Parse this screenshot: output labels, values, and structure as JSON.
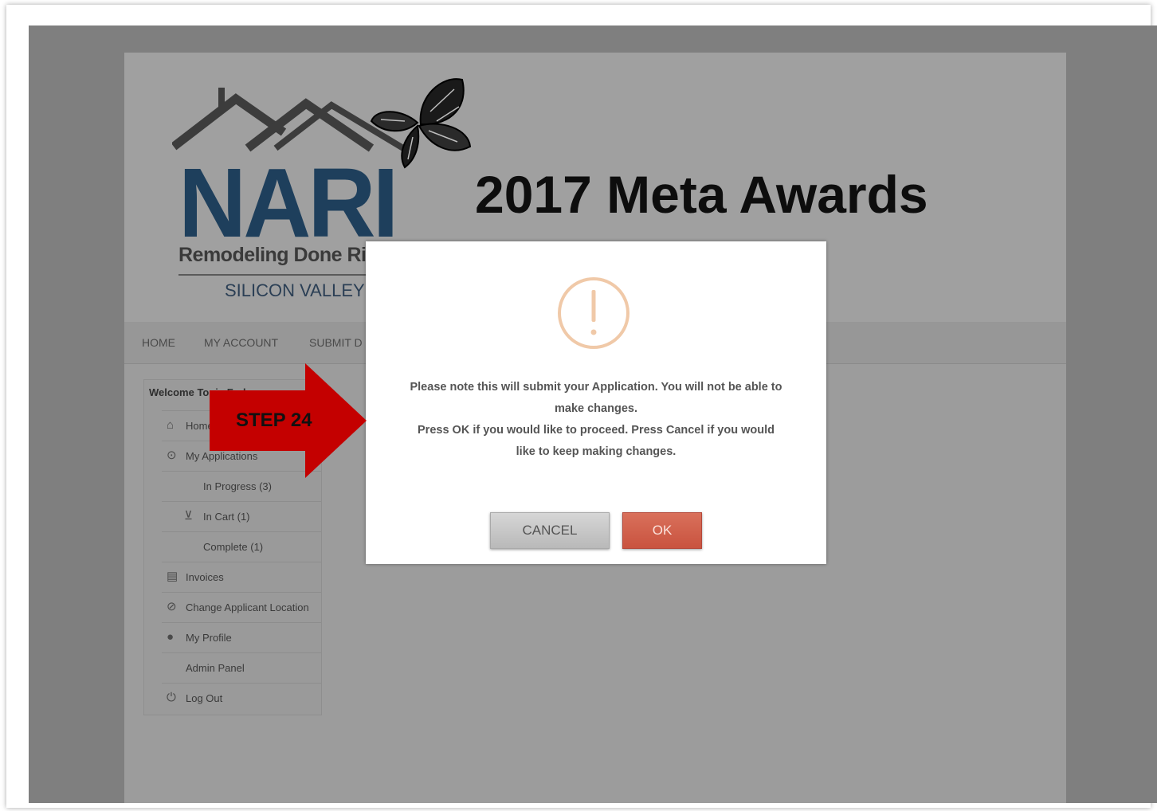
{
  "logo": {
    "wordmark": "NARI",
    "tagline": "Remodeling Done Right",
    "region": "SILICON VALLEY"
  },
  "header": {
    "title": "2017 Meta Awards"
  },
  "nav": {
    "items": [
      "HOME",
      "MY ACCOUNT",
      "SUBMIT D"
    ]
  },
  "sidebar": {
    "welcome": "Welcome Tonia Fodrus",
    "items": [
      {
        "label": "Home",
        "icon": "home-icon"
      },
      {
        "label": "My Applications",
        "icon": "applications-icon"
      },
      {
        "label": "In Progress (3)",
        "icon": ""
      },
      {
        "label": "In Cart (1)",
        "icon": "cart-icon"
      },
      {
        "label": "Complete (1)",
        "icon": ""
      },
      {
        "label": "Invoices",
        "icon": "invoice-icon"
      },
      {
        "label": "Change Applicant Location",
        "icon": "location-icon"
      },
      {
        "label": "My Profile",
        "icon": "user-icon"
      },
      {
        "label": "Admin Panel",
        "icon": ""
      },
      {
        "label": "Log Out",
        "icon": "power-icon"
      }
    ]
  },
  "dialog": {
    "line1": "Please note this will submit your Application. You will not be able to",
    "line2": "make changes.",
    "line3": "Press OK if you would like to proceed. Press Cancel if you would",
    "line4": "like to keep making changes.",
    "cancel_label": "CANCEL",
    "ok_label": "OK",
    "icon": "warning-icon"
  },
  "annotation": {
    "step_label": "STEP 24",
    "color": "#cc0000"
  }
}
